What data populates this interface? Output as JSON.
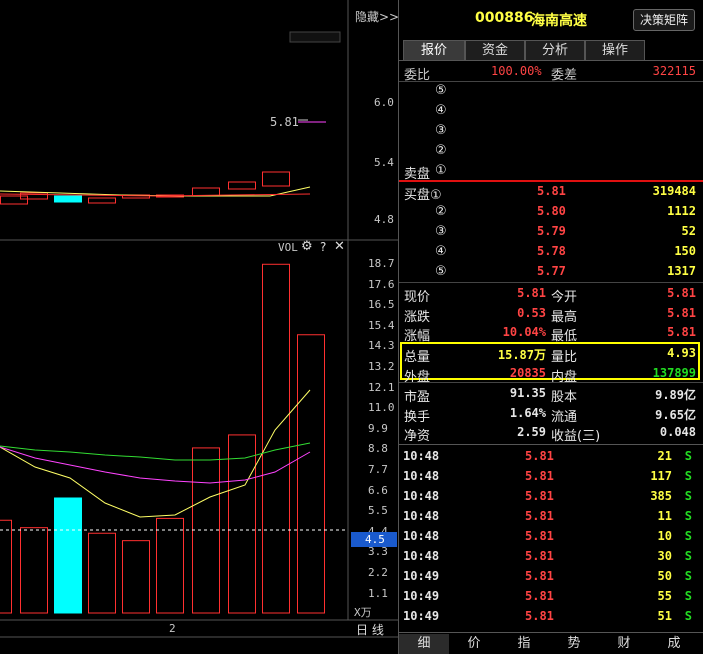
{
  "header": {
    "hide_label": "隐藏>>",
    "stock_code": "000886",
    "stock_name": "海南高速",
    "decision_button": "决策矩阵"
  },
  "tabs": [
    "报价",
    "资金",
    "分析",
    "操作"
  ],
  "order_stats": {
    "ratio_label": "委比",
    "ratio_value": "100.00%",
    "diff_label": "委差",
    "diff_value": "322115"
  },
  "sell_orders": [
    {
      "mark": "⑤"
    },
    {
      "mark": "④"
    },
    {
      "mark": "③"
    },
    {
      "mark": "②"
    },
    {
      "mark": "①",
      "label": "卖盘"
    }
  ],
  "buy_orders": [
    {
      "label": "买盘①",
      "price": "5.81",
      "volume": "319484"
    },
    {
      "label": "②",
      "price": "5.80",
      "volume": "1112"
    },
    {
      "label": "③",
      "price": "5.79",
      "volume": "52"
    },
    {
      "label": "④",
      "price": "5.78",
      "volume": "150"
    },
    {
      "label": "⑤",
      "price": "5.77",
      "volume": "1317"
    }
  ],
  "quote": [
    {
      "l1": "现价",
      "v1": "5.81",
      "l2": "今开",
      "v2": "5.81"
    },
    {
      "l1": "涨跌",
      "v1": "0.53",
      "l2": "最高",
      "v2": "5.81"
    },
    {
      "l1": "涨幅",
      "v1": "10.04%",
      "l2": "最低",
      "v2": "5.81"
    }
  ],
  "volume_box": [
    {
      "l1": "总量",
      "v1": "15.87万",
      "l2": "量比",
      "v2": "4.93"
    },
    {
      "l1": "外盘",
      "v1": "20835",
      "l2": "内盘",
      "v2": "137899"
    }
  ],
  "fundamentals": [
    {
      "l1": "市盈",
      "v1": "91.35",
      "l2": "股本",
      "v2": "9.89亿"
    },
    {
      "l1": "换手",
      "v1": "1.64%",
      "l2": "流通",
      "v2": "9.65亿"
    },
    {
      "l1": "净资",
      "v1": "2.59",
      "l2": "收益(三)",
      "v2": "0.048"
    }
  ],
  "ticks": [
    {
      "time": "10:48",
      "price": "5.81",
      "volume": "21",
      "side": "S"
    },
    {
      "time": "10:48",
      "price": "5.81",
      "volume": "117",
      "side": "S"
    },
    {
      "time": "10:48",
      "price": "5.81",
      "volume": "385",
      "side": "S"
    },
    {
      "time": "10:48",
      "price": "5.81",
      "volume": "11",
      "side": "S"
    },
    {
      "time": "10:48",
      "price": "5.81",
      "volume": "10",
      "side": "S"
    },
    {
      "time": "10:48",
      "price": "5.81",
      "volume": "30",
      "side": "S"
    },
    {
      "time": "10:49",
      "price": "5.81",
      "volume": "50",
      "side": "S"
    },
    {
      "time": "10:49",
      "price": "5.81",
      "volume": "55",
      "side": "S"
    },
    {
      "time": "10:49",
      "price": "5.81",
      "volume": "51",
      "side": "S"
    }
  ],
  "bottom_tabs": [
    "细",
    "价",
    "指",
    "势",
    "财",
    "成"
  ],
  "chart": {
    "price_label": "5.81",
    "price_axis": [
      "6.0",
      "5.4",
      "4.8"
    ],
    "vol_label": "VOL",
    "vol_axis": [
      "18.7",
      "17.6",
      "16.5",
      "15.4",
      "14.3",
      "13.2",
      "12.1",
      "11.0",
      "9.9",
      "8.8",
      "7.7",
      "6.6",
      "5.5",
      "4.4",
      "3.3",
      "2.2",
      "1.1"
    ],
    "vol_current": "4.5",
    "vol_unit": "X万",
    "x_label": "2",
    "period_label": "日 线",
    "colors": {
      "up": "#ff3030",
      "down": "#00ffff",
      "ma1": "#ffff66",
      "ma2": "#ff44ff",
      "ma3": "#33dd33"
    }
  },
  "chart_data": {
    "type": "bar",
    "title": "",
    "xlabel": "",
    "ylabel": "",
    "ylim": [
      0,
      19.3
    ],
    "series": [
      {
        "values": [
          5.0,
          4.6,
          6.2,
          4.3,
          3.9,
          5.1,
          8.9,
          9.6,
          18.8,
          15.0
        ]
      }
    ]
  }
}
